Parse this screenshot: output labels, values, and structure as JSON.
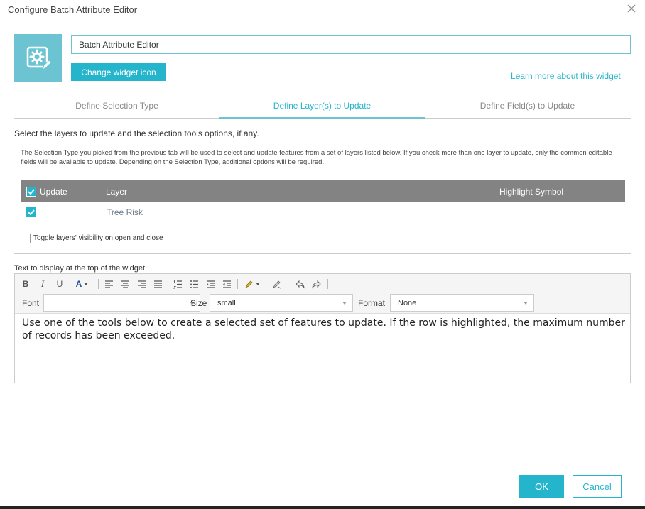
{
  "dialog": {
    "title": "Configure Batch Attribute Editor"
  },
  "widget": {
    "name_value": "Batch Attribute Editor",
    "change_icon_label": "Change widget icon",
    "learn_more_label": "Learn more about this widget"
  },
  "tabs": [
    {
      "label": "Define Selection Type",
      "active": false
    },
    {
      "label": "Define Layer(s) to Update",
      "active": true
    },
    {
      "label": "Define Field(s) to Update",
      "active": false
    }
  ],
  "layers_section": {
    "intro": "Select the layers to update and the selection tools options, if any.",
    "description": "The Selection Type you picked from the previous tab will be used to select and update features from a set of layers listed below. If you check more than one layer to update, only the common editable fields will be available to update. Depending on the Selection Type, additional options will be required.",
    "table": {
      "headers": [
        "Update",
        "Layer",
        "Highlight Symbol"
      ],
      "rows": [
        {
          "checked": true,
          "layer": "Tree Risk"
        }
      ]
    },
    "toggle_visibility_label": "Toggle layers' visibility on open and close"
  },
  "editor": {
    "label": "Text to display at the top of the widget",
    "toolbar": {
      "bold": "B",
      "italic": "I",
      "underline": "U",
      "color_letter": "A"
    },
    "font_label": "Font",
    "font_value": "",
    "size_label": "Size",
    "size_value": "small",
    "format_label": "Format",
    "format_value": "None",
    "content": "Use one of the tools below to create a selected set of features to update. If the row is highlighted, the maximum number of records has been exceeded."
  },
  "footer": {
    "ok_label": "OK",
    "cancel_label": "Cancel"
  },
  "colors": {
    "accent": "#24b5cc",
    "icon_bg": "#6cc4d3",
    "table_header": "#838383"
  }
}
